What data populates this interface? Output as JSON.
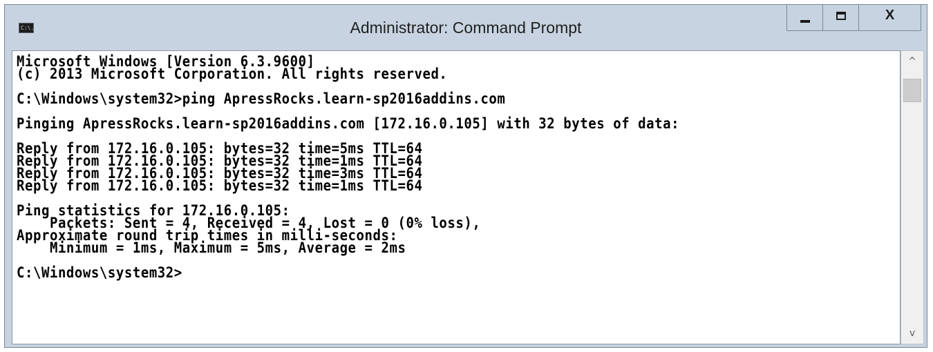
{
  "window": {
    "title": "Administrator: Command Prompt",
    "icon_name": "cmd-app-icon",
    "icon_text": "C:\\."
  },
  "caption_buttons": {
    "minimize_icon": "minimize-icon",
    "maximize_icon": "maximize-icon",
    "close_label": "X"
  },
  "console": {
    "lines": [
      "Microsoft Windows [Version 6.3.9600]",
      "(c) 2013 Microsoft Corporation. All rights reserved.",
      "",
      "C:\\Windows\\system32>ping ApressRocks.learn-sp2016addins.com",
      "",
      "Pinging ApressRocks.learn-sp2016addins.com [172.16.0.105] with 32 bytes of data:",
      "",
      "Reply from 172.16.0.105: bytes=32 time=5ms TTL=64",
      "Reply from 172.16.0.105: bytes=32 time=1ms TTL=64",
      "Reply from 172.16.0.105: bytes=32 time=3ms TTL=64",
      "Reply from 172.16.0.105: bytes=32 time=1ms TTL=64",
      "",
      "Ping statistics for 172.16.0.105:",
      "    Packets: Sent = 4, Received = 4, Lost = 0 (0% loss),",
      "Approximate round trip times in milli-seconds:",
      "    Minimum = 1ms, Maximum = 5ms, Average = 2ms",
      "",
      "C:\\Windows\\system32>"
    ]
  },
  "scrollbar": {
    "up_arrow": "^",
    "down_arrow": "v"
  },
  "colors": {
    "frame": "#c7d3e0",
    "console_background": "#ffffff",
    "console_text": "#000000"
  }
}
